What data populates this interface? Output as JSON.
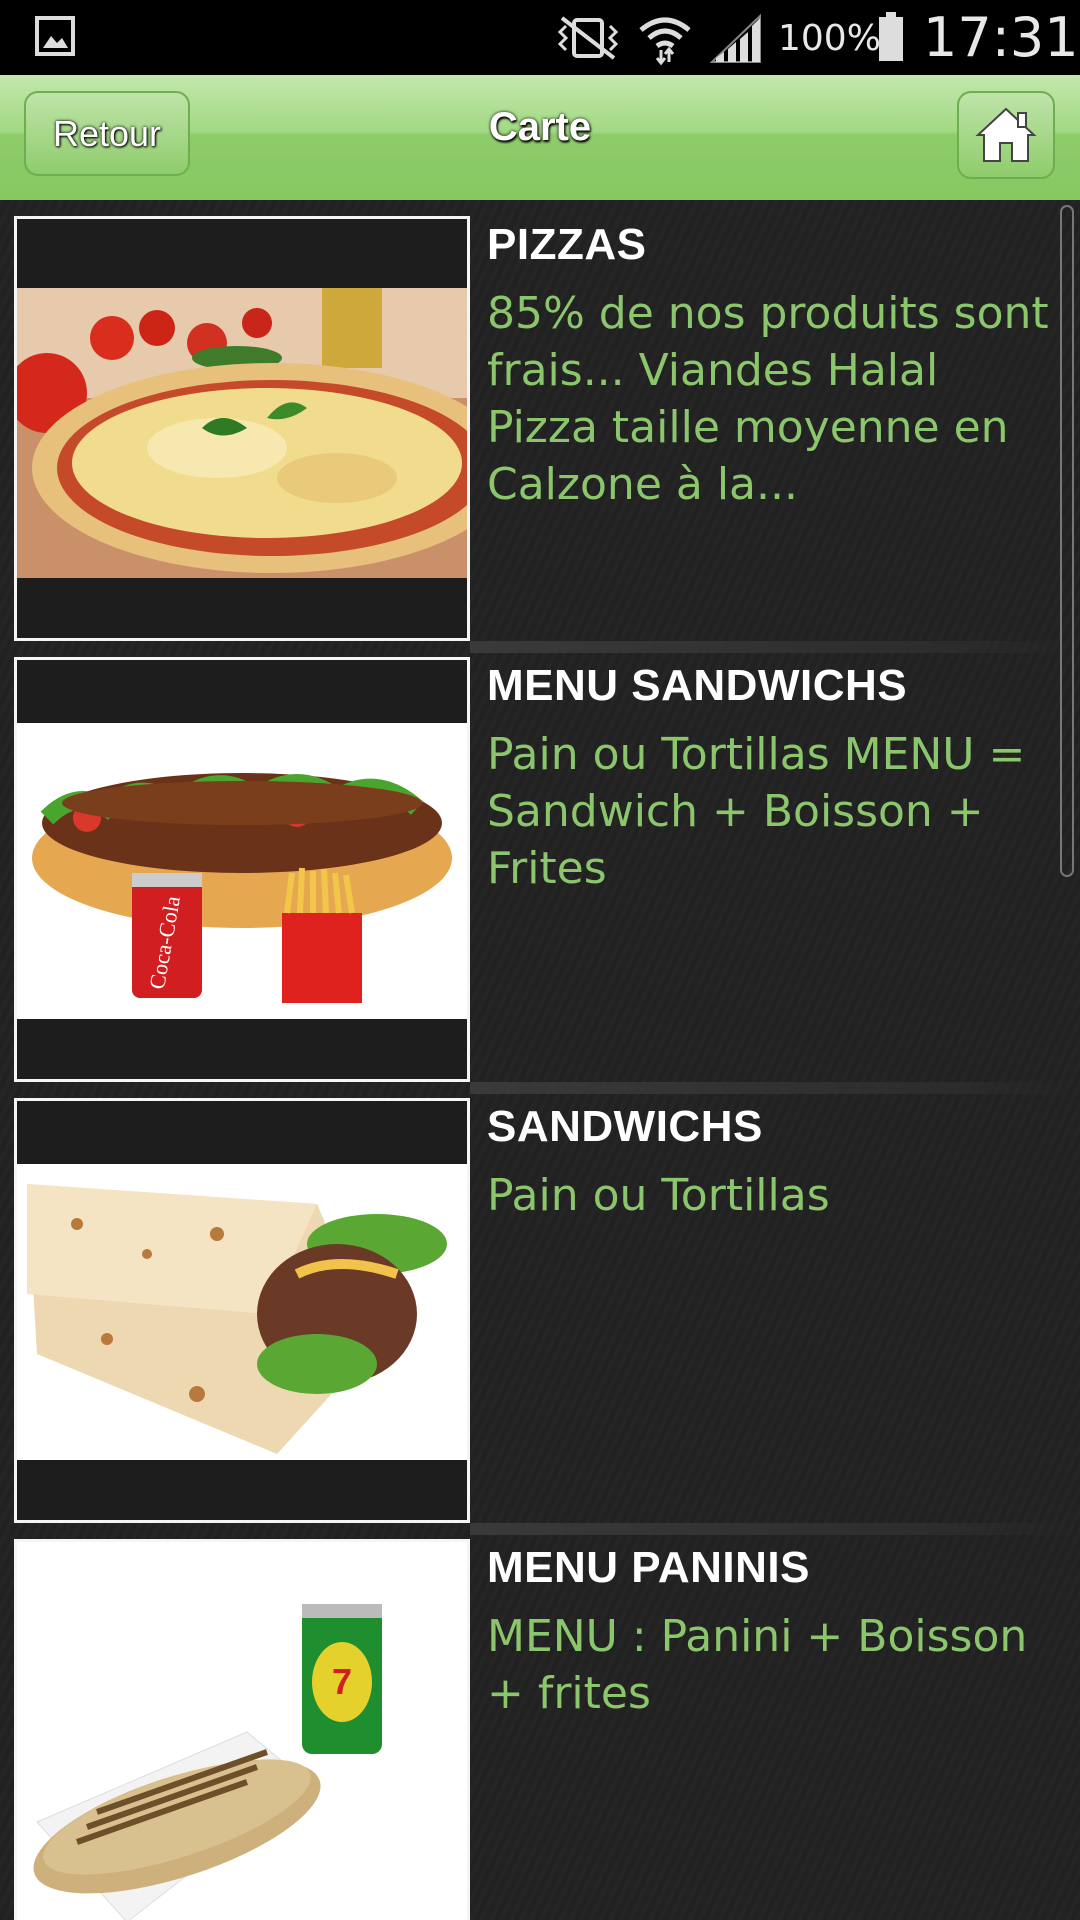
{
  "status_bar": {
    "battery_pct": "100%",
    "time": "17:31",
    "icons": [
      "gallery-notification-icon",
      "vibrate-icon",
      "wifi-icon",
      "signal-icon",
      "battery-icon"
    ]
  },
  "header": {
    "back_label": "Retour",
    "title": "Carte",
    "home_icon": "home-icon"
  },
  "colors": {
    "header_green": "#9ed87f",
    "desc_green": "#8cc66c",
    "background": "#222222"
  },
  "items": [
    {
      "title": "PIZZAS",
      "description": "85% de nos produits sont frais... Viandes Halal Pizza taille moyenne en Calzone à la...",
      "image": "pizza-image"
    },
    {
      "title": "MENU SANDWICHS",
      "description": "Pain ou Tortillas MENU = Sandwich + Boisson + Frites",
      "image": "sandwich-menu-image"
    },
    {
      "title": "SANDWICHS",
      "description": "Pain ou Tortillas",
      "image": "wrap-image"
    },
    {
      "title": "MENU PANINIS",
      "description": "MENU : Panini + Boisson + frites",
      "image": "panini-menu-image"
    }
  ]
}
